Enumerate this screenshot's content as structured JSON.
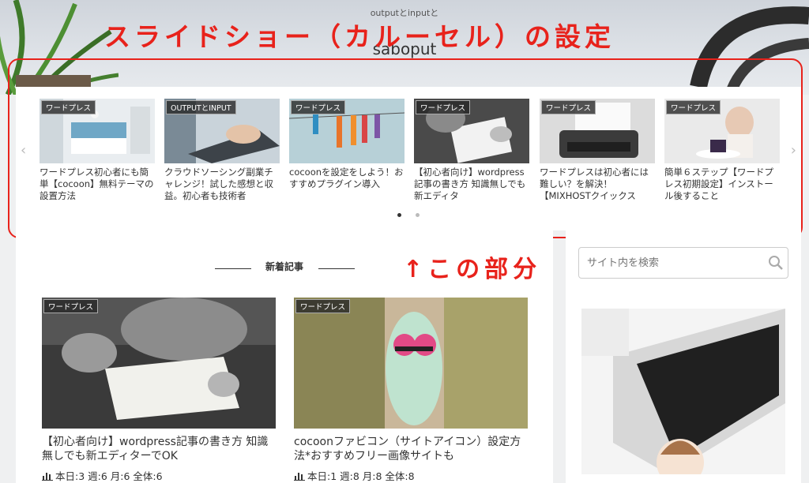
{
  "header": {
    "tagline": "outputとinputと",
    "site_title": "saboput"
  },
  "annotations": {
    "title": "スライドショー（カルーセル）の設定",
    "pointer": "↑この部分"
  },
  "carousel": {
    "prev_icon": "chevron-left-icon",
    "next_icon": "chevron-right-icon",
    "cards": [
      {
        "category": "ワードプレス",
        "title": "ワードプレス初心者にも簡単【cocoon】無料テーマの設置方法"
      },
      {
        "category": "OUTPUTとINPUT",
        "title": "クラウドソーシング副業チャレンジ！試した感想と収益。初心者も技術者"
      },
      {
        "category": "ワードプレス",
        "title": "cocoonを設定をしよう！おすすめプラグイン導入"
      },
      {
        "category": "ワードプレス",
        "title": "【初心者向け】wordpress記事の書き方 知識無しでも新エディタ"
      },
      {
        "category": "ワードプレス",
        "title": "ワードプレスは初心者には難しい？を解決！【MIXHOSTクイックス"
      },
      {
        "category": "ワードプレス",
        "title": "簡単６ステップ【ワードプレス初期設定】インストール後すること"
      }
    ],
    "active_dot": 0,
    "dot_count": 2
  },
  "main": {
    "section_heading": "新着記事",
    "posts": [
      {
        "category": "ワードプレス",
        "title": "【初心者向け】wordpress記事の書き方 知識無しでも新エディターでOK",
        "stats": "本日:3 週:6 月:6 全体:6"
      },
      {
        "category": "ワードプレス",
        "title": "cocoonファビコン（サイトアイコン）設定方法*おすすめフリー画像サイトも",
        "stats": "本日:1 週:8 月:8 全体:8"
      }
    ]
  },
  "sidebar": {
    "search_placeholder": "サイト内を検索"
  },
  "colors": {
    "annotation_red": "#e8221b",
    "background": "#eff0f1"
  }
}
